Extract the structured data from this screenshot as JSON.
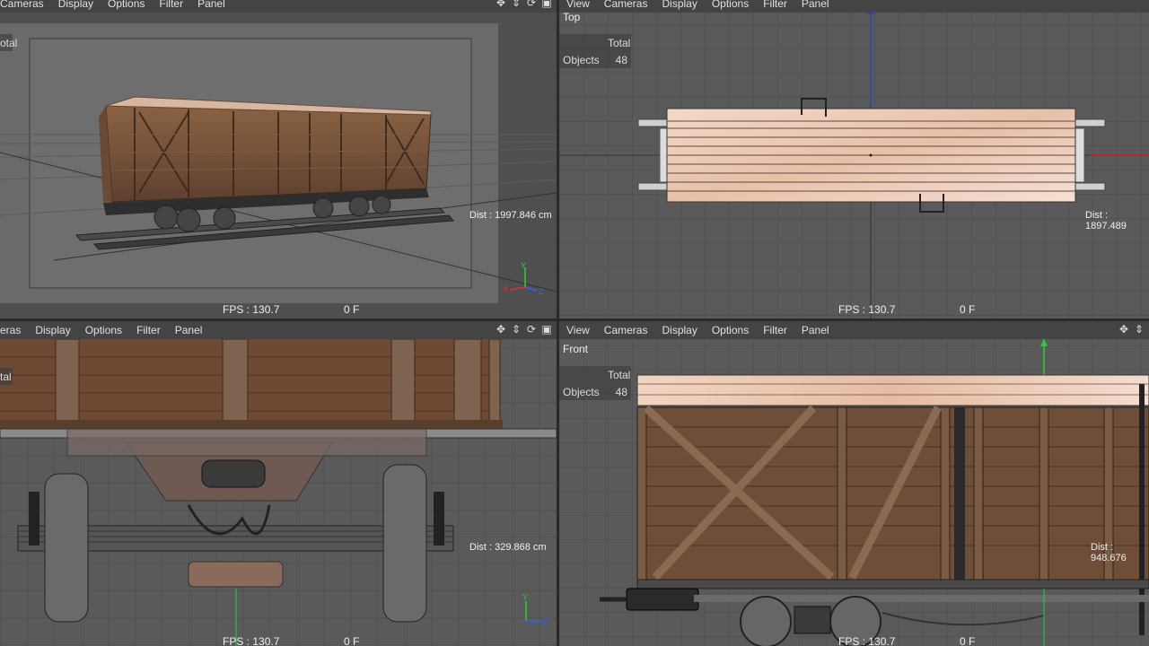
{
  "menu": {
    "view": "View",
    "cameras": "Cameras",
    "display": "Display",
    "options": "Options",
    "filter": "Filter",
    "panel": "Panel",
    "cameras_cut": "eras"
  },
  "viewports": {
    "perspective": {
      "stats_total_cut": "otal",
      "dist": "Dist : 1997.846 cm",
      "fps": "FPS : 130.7",
      "frame": "0 F"
    },
    "top": {
      "label": "Top",
      "stats_total": "Total",
      "stats_objects": "Objects",
      "stats_objects_value": "48",
      "dist": "Dist : 1897.489",
      "fps": "FPS : 130.7",
      "frame": "0 F"
    },
    "right": {
      "stats_total_cut": "tal",
      "dist": "Dist : 329.868 cm",
      "fps": "FPS : 130.7",
      "frame": "0 F"
    },
    "front": {
      "label": "Front",
      "stats_total": "Total",
      "stats_objects": "Objects",
      "stats_objects_value": "48",
      "dist": "Dist : 948.676",
      "fps": "FPS : 130.7",
      "frame": "0 F"
    }
  },
  "axis_labels": {
    "x": "X",
    "y": "Y",
    "z": "Z"
  },
  "icons": [
    "move-icon",
    "zoom-icon",
    "rotate-icon",
    "maximize-icon"
  ]
}
